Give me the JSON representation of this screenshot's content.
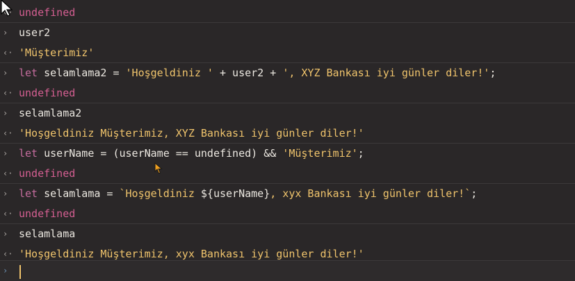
{
  "console": {
    "rows": [
      {
        "kind": "output",
        "gutter": "‹·",
        "segments": [
          {
            "c": "undef",
            "t": "undefined"
          }
        ]
      },
      {
        "kind": "input",
        "gutter": "›",
        "segments": [
          {
            "c": "plain",
            "t": "user2"
          }
        ]
      },
      {
        "kind": "output",
        "gutter": "‹·",
        "segments": [
          {
            "c": "str",
            "t": "'Müşterimiz'"
          }
        ]
      },
      {
        "kind": "input",
        "gutter": "›",
        "segments": [
          {
            "c": "kw",
            "t": "let "
          },
          {
            "c": "plain",
            "t": "selamlama2 = "
          },
          {
            "c": "str",
            "t": "'Hoşgeldiniz '"
          },
          {
            "c": "plain",
            "t": " + user2 + "
          },
          {
            "c": "str",
            "t": "', XYZ Bankası iyi günler diler!'"
          },
          {
            "c": "plain",
            "t": ";"
          }
        ]
      },
      {
        "kind": "output",
        "gutter": "‹·",
        "segments": [
          {
            "c": "undef",
            "t": "undefined"
          }
        ]
      },
      {
        "kind": "input",
        "gutter": "›",
        "segments": [
          {
            "c": "plain",
            "t": "selamlama2"
          }
        ]
      },
      {
        "kind": "output",
        "gutter": "‹·",
        "segments": [
          {
            "c": "str",
            "t": "'Hoşgeldiniz Müşterimiz, XYZ Bankası iyi günler diler!'"
          }
        ]
      },
      {
        "kind": "input",
        "gutter": "›",
        "segments": [
          {
            "c": "kw",
            "t": "let "
          },
          {
            "c": "plain",
            "t": "userName = (userName == undefined) && "
          },
          {
            "c": "str",
            "t": "'Müşterimiz'"
          },
          {
            "c": "plain",
            "t": ";"
          }
        ]
      },
      {
        "kind": "output",
        "gutter": "‹·",
        "segments": [
          {
            "c": "undef",
            "t": "undefined"
          }
        ]
      },
      {
        "kind": "input",
        "gutter": "›",
        "segments": [
          {
            "c": "kw",
            "t": "let "
          },
          {
            "c": "plain",
            "t": "selamlama = "
          },
          {
            "c": "str",
            "t": "`Hoşgeldiniz "
          },
          {
            "c": "plain",
            "t": "${userName}"
          },
          {
            "c": "str",
            "t": ", xyx Bankası iyi günler diler!`"
          },
          {
            "c": "plain",
            "t": ";"
          }
        ]
      },
      {
        "kind": "output",
        "gutter": "‹·",
        "segments": [
          {
            "c": "undef",
            "t": "undefined"
          }
        ]
      },
      {
        "kind": "input",
        "gutter": "›",
        "segments": [
          {
            "c": "plain",
            "t": "selamlama"
          }
        ]
      },
      {
        "kind": "output",
        "gutter": "‹·",
        "segments": [
          {
            "c": "str",
            "t": "'Hoşgeldiniz Müşterimiz, xyx Bankası iyi günler diler!'"
          }
        ]
      }
    ],
    "prompt": {
      "gutter": "›",
      "value": ""
    }
  },
  "colors": {
    "background": "#2a2728",
    "keyword": "#c46c9d",
    "string": "#f0c46c",
    "undefined": "#d55f92",
    "text": "#ece8e1"
  },
  "icons": {
    "input_marker": "chevron-right-icon",
    "output_marker": "return-arrow-icon",
    "mouse_cursor": "arrow-cursor-icon",
    "pointer_cursor": "pointer-cursor-icon"
  }
}
